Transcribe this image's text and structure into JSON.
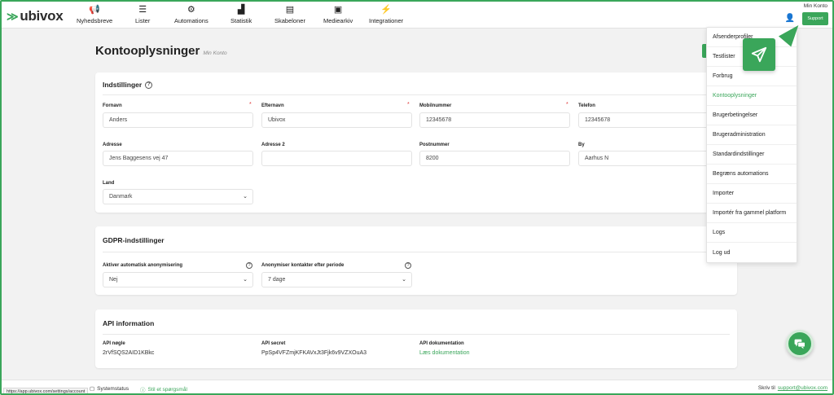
{
  "brand": {
    "name": "ubivox",
    "accent": "#3aa65a"
  },
  "nav": {
    "items": [
      {
        "label": "Nyhedsbreve",
        "icon": "megaphone-icon",
        "glyph": "📢"
      },
      {
        "label": "Lister",
        "icon": "list-icon",
        "glyph": "☰"
      },
      {
        "label": "Automations",
        "icon": "cogs-icon",
        "glyph": "⚙"
      },
      {
        "label": "Statistik",
        "icon": "bar-chart-icon",
        "glyph": "▟"
      },
      {
        "label": "Skabeloner",
        "icon": "template-icon",
        "glyph": "▤"
      },
      {
        "label": "Mediearkiv",
        "icon": "media-icon",
        "glyph": "▣"
      },
      {
        "label": "Integrationer",
        "icon": "plug-icon",
        "glyph": "⚡"
      }
    ],
    "account_label": "Min Konto",
    "support_label": "Support"
  },
  "page": {
    "title": "Kontooplysninger",
    "subtitle": "Min Konto"
  },
  "settings": {
    "title": "Indstillinger",
    "fields": {
      "fornavn": {
        "label": "Fornavn",
        "value": "Anders"
      },
      "efternavn": {
        "label": "Efternavn",
        "value": "Ubivox"
      },
      "mobil": {
        "label": "Mobilnummer",
        "value": "12345678"
      },
      "telefon": {
        "label": "Telefon",
        "value": "12345678"
      },
      "adresse": {
        "label": "Adresse",
        "value": "Jens Baggesens vej 47"
      },
      "adresse2": {
        "label": "Adresse 2",
        "value": ""
      },
      "postnummer": {
        "label": "Postnummer",
        "value": "8200"
      },
      "by": {
        "label": "By",
        "value": "Aarhus N"
      },
      "land": {
        "label": "Land",
        "value": "Danmark"
      }
    }
  },
  "gdpr": {
    "title": "GDPR-indstillinger",
    "auto_anon": {
      "label": "Aktiver automatisk anonymisering",
      "value": "Nej"
    },
    "anon_period": {
      "label": "Anonymiser kontakter efter periode",
      "value": "7 dage"
    }
  },
  "api": {
    "title": "API information",
    "key": {
      "label": "API nøgle",
      "value": "2rVfSQS2AID1KBkc"
    },
    "secret": {
      "label": "API secret",
      "value": "PpSp4VFZmjKFKAVxJt3Fjk6v9VZXOuA3"
    },
    "docs": {
      "label": "API dokumentation",
      "link": "Læs dokumentation"
    }
  },
  "menu": {
    "items": [
      "Afsenderprofiler",
      "Testlister",
      "Forbrug",
      "Kontooplysninger",
      "Brugerbetingelser",
      "Brugeradministration",
      "Standardindstillinger",
      "Begræns automations",
      "Importer",
      "Importér fra gammel platform",
      "Logs",
      "Log ud"
    ],
    "active_index": 3
  },
  "footer": {
    "systemstatus": "Systemstatus",
    "ask": "Stil et spørgsmål",
    "write_to": "Skriv til",
    "email": "support@ubivox.com"
  },
  "statusbar": {
    "url": "https://app.ubivox.com/settings/account"
  }
}
